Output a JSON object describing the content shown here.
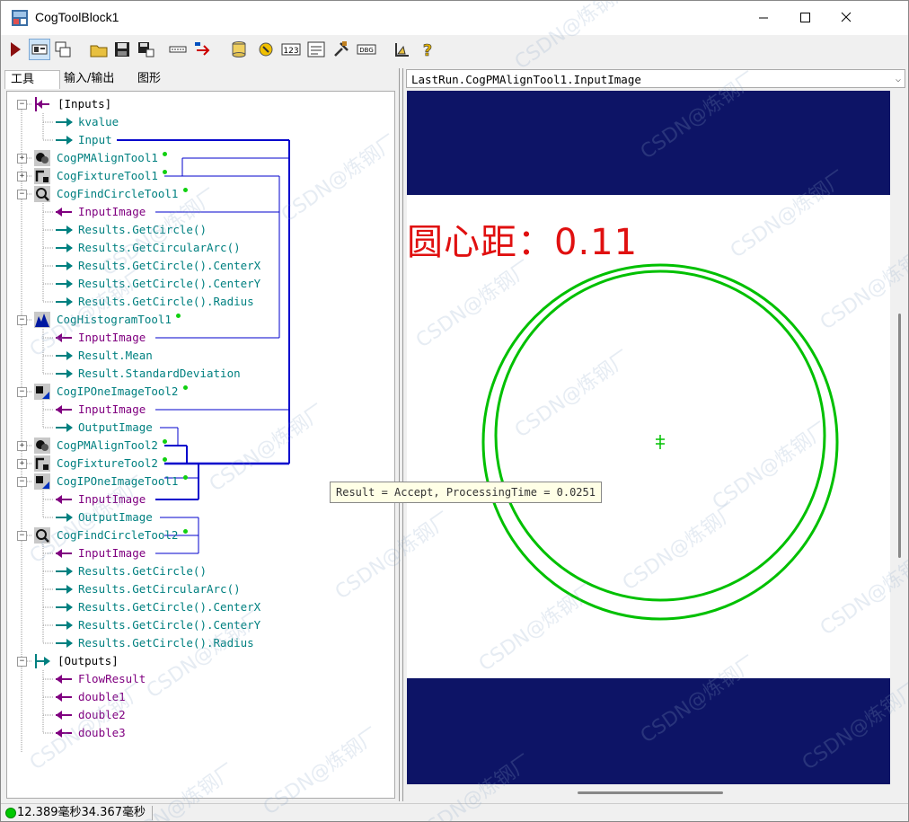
{
  "window": {
    "title": "CogToolBlock1"
  },
  "tabs": [
    "工具",
    "输入/输出",
    "图形"
  ],
  "tree": {
    "rows": [
      {
        "text": "[Inputs]",
        "color": "black"
      },
      {
        "text": "kvalue",
        "color": "teal"
      },
      {
        "text": "Input",
        "color": "teal"
      },
      {
        "text": "CogPMAlignTool1",
        "color": "teal"
      },
      {
        "text": "CogFixtureTool1",
        "color": "teal"
      },
      {
        "text": "CogFindCircleTool1",
        "color": "teal"
      },
      {
        "text": "InputImage",
        "color": "purple"
      },
      {
        "text": "Results.GetCircle()",
        "color": "teal"
      },
      {
        "text": "Results.GetCircularArc()",
        "color": "teal"
      },
      {
        "text": "Results.GetCircle().CenterX",
        "color": "teal"
      },
      {
        "text": "Results.GetCircle().CenterY",
        "color": "teal"
      },
      {
        "text": "Results.GetCircle().Radius",
        "color": "teal"
      },
      {
        "text": "CogHistogramTool1",
        "color": "teal"
      },
      {
        "text": "InputImage",
        "color": "purple"
      },
      {
        "text": "Result.Mean",
        "color": "teal"
      },
      {
        "text": "Result.StandardDeviation",
        "color": "teal"
      },
      {
        "text": "CogIPOneImageTool2",
        "color": "teal"
      },
      {
        "text": "InputImage",
        "color": "purple"
      },
      {
        "text": "OutputImage",
        "color": "teal"
      },
      {
        "text": "CogPMAlignTool2",
        "color": "teal"
      },
      {
        "text": "CogFixtureTool2",
        "color": "teal"
      },
      {
        "text": "CogIPOneImageTool1",
        "color": "teal"
      },
      {
        "text": "InputImage",
        "color": "purple"
      },
      {
        "text": "OutputImage",
        "color": "teal"
      },
      {
        "text": "CogFindCircleTool2",
        "color": "teal"
      },
      {
        "text": "InputImage",
        "color": "purple"
      },
      {
        "text": "Results.GetCircle()",
        "color": "teal"
      },
      {
        "text": "Results.GetCircularArc()",
        "color": "teal"
      },
      {
        "text": "Results.GetCircle().CenterX",
        "color": "teal"
      },
      {
        "text": "Results.GetCircle().CenterY",
        "color": "teal"
      },
      {
        "text": "Results.GetCircle().Radius",
        "color": "teal"
      },
      {
        "text": "[Outputs]",
        "color": "black"
      },
      {
        "text": "FlowResult",
        "color": "purple"
      },
      {
        "text": "double1",
        "color": "purple"
      },
      {
        "text": "double2",
        "color": "purple"
      },
      {
        "text": "double3",
        "color": "purple"
      }
    ]
  },
  "display": {
    "selector": "LastRun.CogPMAlignTool1.InputImage",
    "overlay_text": "圆心距：0.11"
  },
  "tooltip": "Result = Accept, ProcessingTime = 0.0251",
  "status": {
    "time1": "12.389毫秒",
    "time2": "34.367毫秒"
  },
  "watermark": "CSDN@炼钢厂",
  "colors": {
    "band": "#0d1466",
    "circle": "#00c000",
    "overlay_text": "#e01010",
    "link": "#0000cc"
  }
}
